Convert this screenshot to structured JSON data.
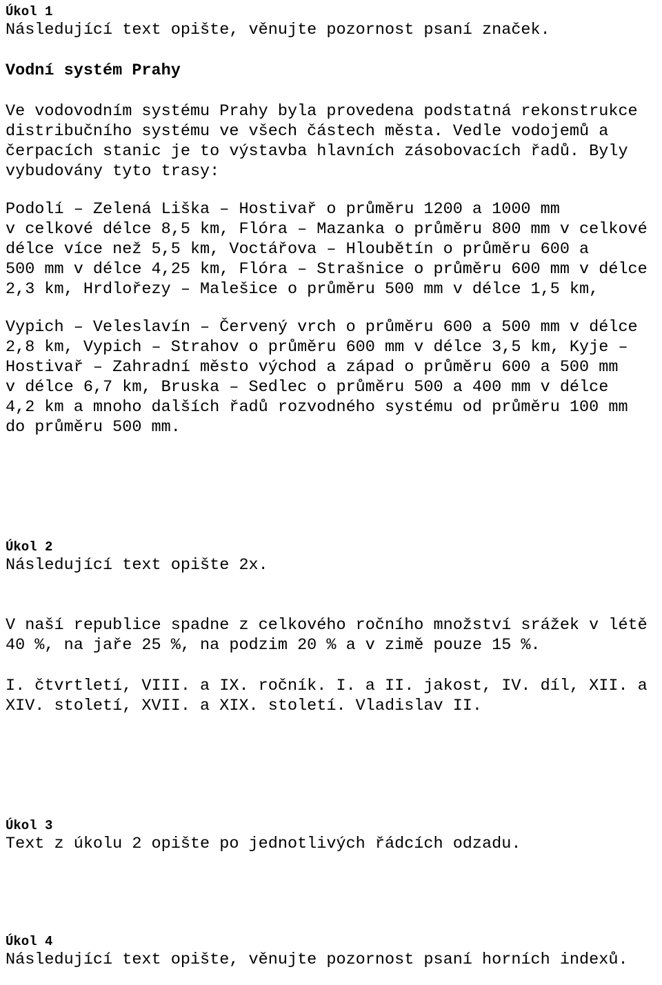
{
  "document": {
    "language": "cs",
    "background_color": "#ffffff",
    "text_color": "#000000"
  },
  "tasks": [
    {
      "id": "ukol-1",
      "title": "Úkol 1",
      "instruction": "Následující text opište, věnujte pozornost psaní značek.",
      "content_heading": "Vodní systém Prahy",
      "paragraph_lines": [
        "Ve vodovodním systému Prahy byla provedena podstatná rekonstrukce",
        "distribučního systému ve všech částech města. Vedle vodojemů a",
        "čerpacích stanic je to výstavba hlavních zásobovacích řadů. Byly",
        "vybudovány tyto trasy:"
      ],
      "routes_block_1": [
        "Podolí – Zelená Liška – Hostivař o průměru 1200 a 1000 mm",
        "v celkové délce 8,5 km, Flóra – Mazanka o průměru 800 mm v celkové",
        "délce více než 5,5 km, Voctářova – Hloubětín o průměru 600 a",
        "500 mm v délce 4,25 km, Flóra – Strašnice o průměru 600 mm v délce",
        "2,3 km, Hrdlořezy – Malešice o průměru 500 mm v délce 1,5 km,"
      ],
      "routes_block_2": [
        "Vypich – Veleslavín – Červený vrch o průměru 600 a 500 mm v délce",
        "2,8 km, Vypich – Strahov o průměru 600 mm v délce 3,5 km, Kyje –",
        "Hostivař – Zahradní město východ a západ o průměru 600 a 500 mm",
        "v délce 6,7 km, Bruska – Sedlec o průměru 500 a 400 mm v délce",
        "4,2 km a mnoho dalších řadů rozvodného systému od průměru 100 mm",
        "do průměru 500 mm."
      ]
    },
    {
      "id": "ukol-2",
      "title": "Úkol 2",
      "instruction": "Následující text opište 2x.",
      "precipitation_lines": [
        "V naší republice spadne z celkového ročního množství srážek v létě",
        "40 %, na jaře 25 %, na podzim 20 % a v zimě pouze 15 %."
      ],
      "roman_numeral_lines": [
        "I. čtvrtletí, VIII. a IX. ročník. I. a II. jakost, IV. díl, XII. a",
        "XIV. století, XVII. a XIX. století. Vladislav II."
      ]
    },
    {
      "id": "ukol-3",
      "title": "Úkol 3",
      "instruction": "Text z úkolu 2 opište po jednotlivých řádcích odzadu."
    },
    {
      "id": "ukol-4",
      "title": "Úkol 4",
      "instruction": "Následující text opište, věnujte pozornost psaní horních indexů."
    }
  ]
}
